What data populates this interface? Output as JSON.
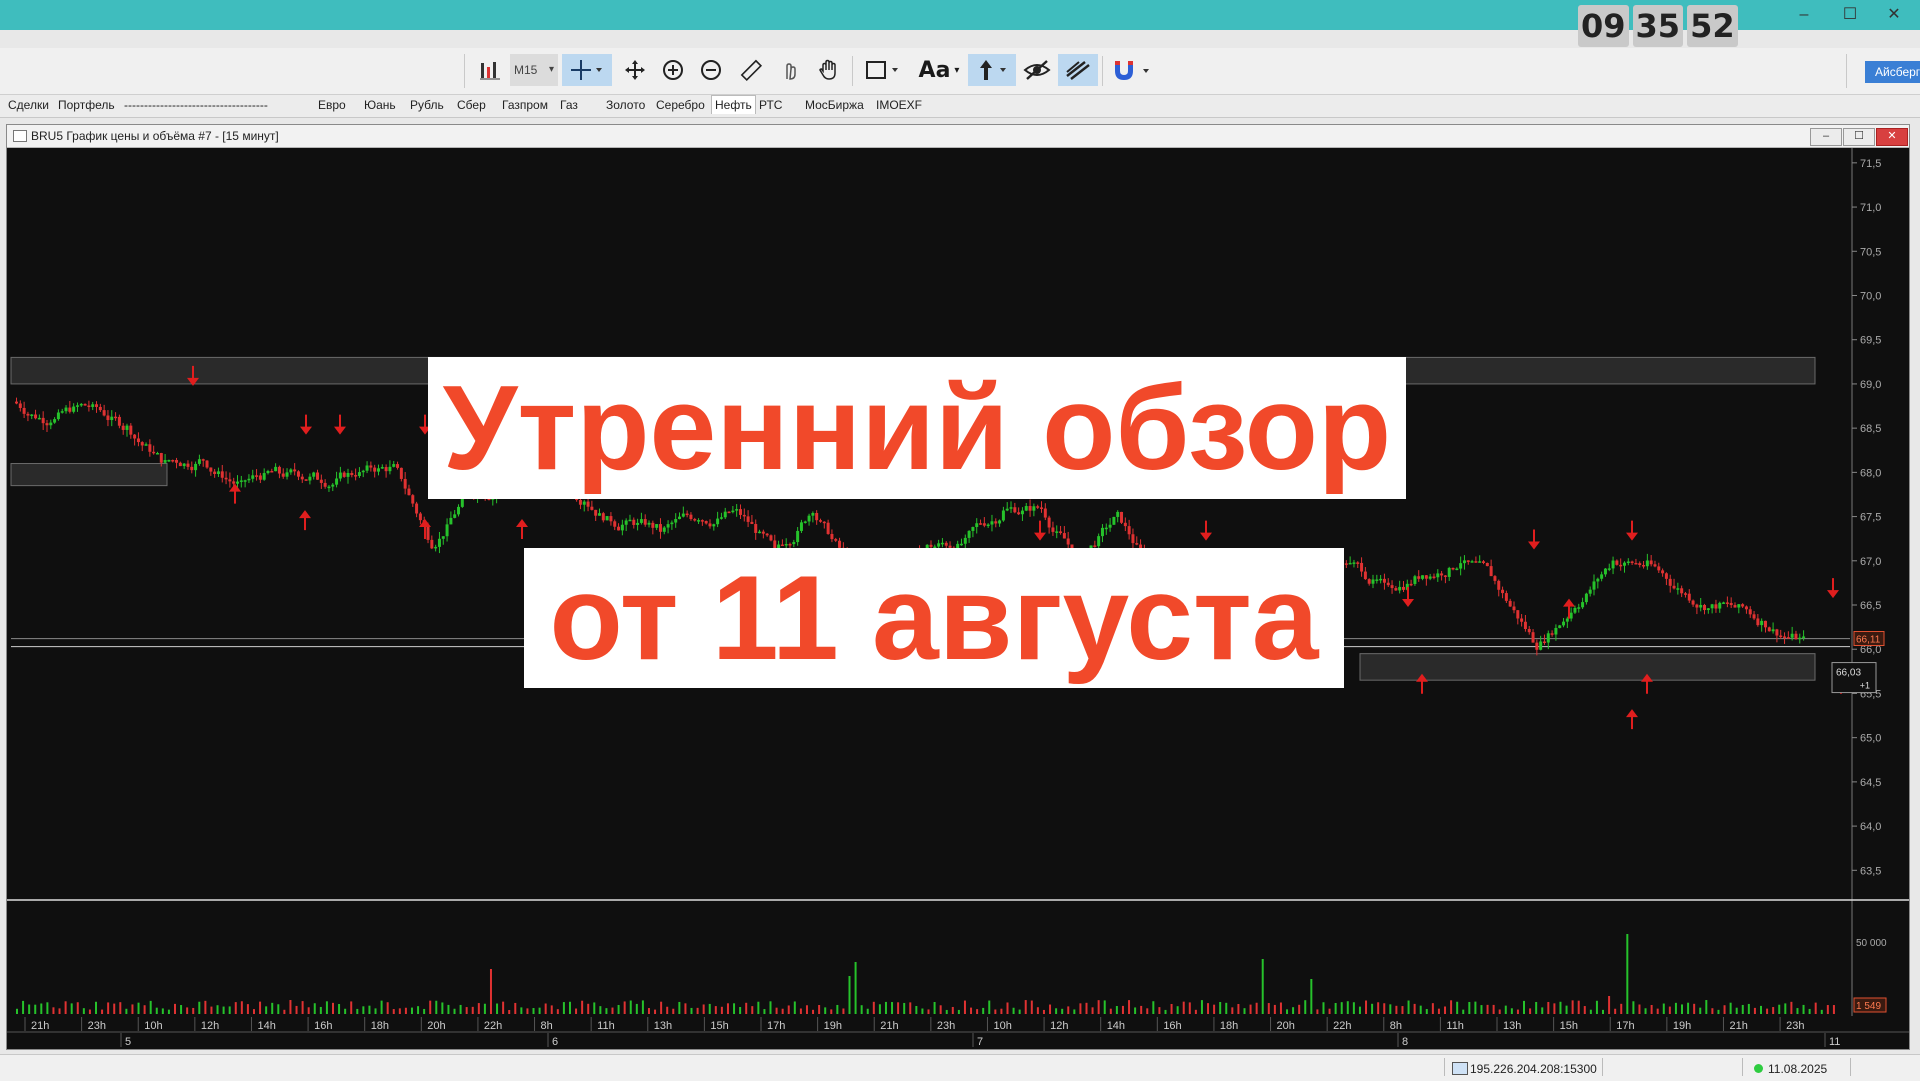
{
  "window": {
    "clock": {
      "hh": "09",
      "mm": "35",
      "ss": "52"
    },
    "controls": {
      "minimize": "–",
      "maximize": "☐",
      "close": "✕"
    }
  },
  "toolbar": {
    "timeframe": "M15",
    "text_tool": "Aa",
    "right_button": "Айсберг"
  },
  "tabs": [
    {
      "label": "Сделки"
    },
    {
      "label": "Портфель"
    },
    {
      "label": "------------------------------------"
    },
    {
      "label": "Евро"
    },
    {
      "label": "Юань"
    },
    {
      "label": "Рубль"
    },
    {
      "label": "Сбер"
    },
    {
      "label": "Газпром"
    },
    {
      "label": "Газ"
    },
    {
      "label": "Золото"
    },
    {
      "label": "Серебро"
    },
    {
      "label": "Нефть",
      "active": true
    },
    {
      "label": "РТС"
    },
    {
      "label": "МосБиржа"
    },
    {
      "label": "IMOEXF"
    }
  ],
  "chart_window": {
    "title": "BRU5 График цены и объёма #7 - [15 минут]",
    "buttons": {
      "min": "–",
      "max": "☐",
      "close": "✕"
    }
  },
  "chart_data": {
    "type": "candlestick",
    "instrument": "BRU5",
    "timeframe": "15 минут",
    "price_axis": {
      "ticks": [
        "71,5",
        "71,0",
        "70,5",
        "70,0",
        "69,5",
        "69,0",
        "68,5",
        "68,0",
        "67,5",
        "67,0",
        "66,5",
        "66,0",
        "65,5",
        "65,0",
        "64,5",
        "64,0",
        "63,5"
      ],
      "range": [
        63.3,
        71.6
      ]
    },
    "last_price_label": "66,11",
    "cursor_label": "66,03",
    "cursor_sublabel": "+1",
    "volume_axis": {
      "ticks": [
        "50 000"
      ],
      "last_volume_label": "1 549"
    },
    "time_axis": {
      "hours": [
        "21h",
        "23h",
        "10h",
        "12h",
        "14h",
        "16h",
        "18h",
        "20h",
        "22h",
        "8h",
        "11h",
        "13h",
        "15h",
        "17h",
        "19h",
        "21h",
        "23h",
        "10h",
        "12h",
        "14h",
        "16h",
        "18h",
        "20h",
        "22h",
        "8h",
        "11h",
        "13h",
        "15h",
        "17h",
        "19h",
        "21h",
        "23h"
      ],
      "dates": [
        "5",
        "6",
        "7",
        "8",
        "11"
      ]
    },
    "zones": [
      {
        "from": 69.3,
        "to": 69.0,
        "note": "resistance"
      },
      {
        "from": 68.1,
        "to": 67.85,
        "note": "left box"
      },
      {
        "from": 65.95,
        "to": 65.65,
        "note": "support"
      }
    ],
    "horizontal_line": 66.03,
    "close_series": [
      68.8,
      68.6,
      68.75,
      68.5,
      68.1,
      68.15,
      67.85,
      68.0,
      67.95,
      68.0,
      68.05,
      67.2,
      67.8,
      67.9,
      68.0,
      67.7,
      67.4,
      67.35,
      67.5,
      67.55,
      67.1,
      67.6,
      66.9,
      66.85,
      67.15,
      67.2,
      67.55,
      67.6,
      67.0,
      67.5,
      66.8,
      66.5,
      66.2,
      66.0,
      66.6,
      67.0,
      66.7,
      66.85,
      67.0,
      66.7,
      66.05,
      66.5,
      67.0,
      66.95,
      66.6,
      66.5,
      66.3,
      66.1
    ]
  },
  "overlay": {
    "line1": "Утренний обзор",
    "line2": "от 11 августа"
  },
  "status": {
    "connection": "195.226.204.208:15300",
    "date": "11.08.2025"
  }
}
